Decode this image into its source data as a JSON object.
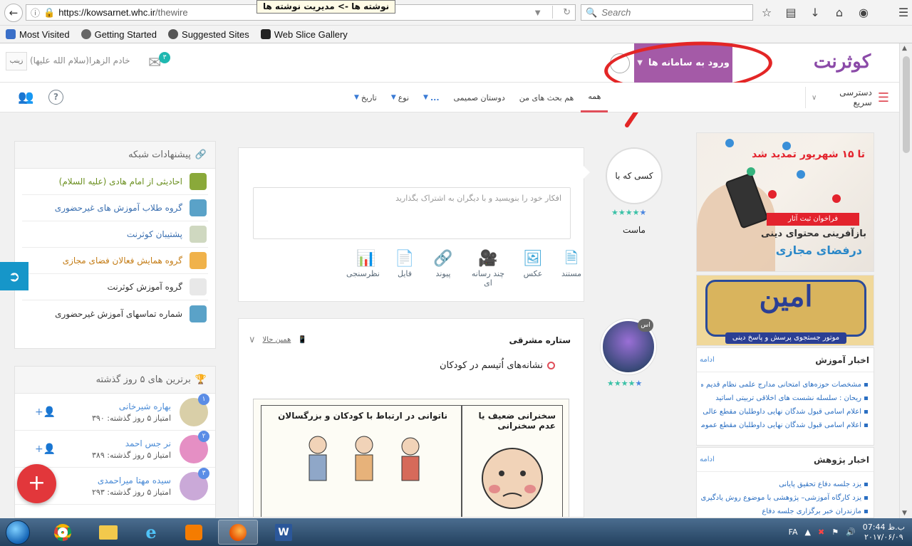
{
  "browser": {
    "url_host": "https://kowsarnet.whc.ir",
    "url_path": "/thewire",
    "tooltip": "نوشته ها -> مدیریت نوشته ها",
    "search_placeholder": "Search"
  },
  "bookmarks": [
    {
      "label": "Most Visited",
      "icon": "star-icon"
    },
    {
      "label": "Getting Started",
      "icon": "firefox-icon"
    },
    {
      "label": "Suggested Sites",
      "icon": "ie-icon"
    },
    {
      "label": "Web Slice Gallery",
      "icon": "slice-icon"
    }
  ],
  "header": {
    "logo_text": "کوثرنت",
    "login_label": "ورود به سامانه ها",
    "admin_name": "خادم الزهرا(سلام الله علیها)",
    "admin_avatar_text": "زینب",
    "mail_count": "۳"
  },
  "subnav": {
    "quick_access": "دسترسی سریع",
    "tabs": [
      {
        "label": "همه",
        "active": true
      },
      {
        "label": "هم بحث های من"
      },
      {
        "label": "دوستان صمیمی"
      },
      {
        "label": "..."
      },
      {
        "label": "نوع"
      },
      {
        "label": "تاریخ"
      }
    ]
  },
  "suggestions": {
    "title": "پیشنهادات شبکه",
    "items": [
      {
        "label": "احادیثی از امام هادی (علیه السلام)",
        "color": "#6a8f1f",
        "thumb": "#8aa93a"
      },
      {
        "label": "گروه طلاب آموزش های غیرحضوری",
        "color": "#3a6fb0",
        "thumb": "#5aa2c8"
      },
      {
        "label": "پشتیبان کوثرنت",
        "color": "#3a6fb0",
        "thumb": "#cfd8c0"
      },
      {
        "label": "گروه همایش فعالان فضای مجازی",
        "color": "#c47d17",
        "thumb": "#f0b24a"
      },
      {
        "label": "گروه آموزش کوثرنت",
        "color": "#333333",
        "thumb": "#e8e8e8"
      },
      {
        "label": "شماره تماسهای آموزش غیرحضوری",
        "color": "#333333",
        "thumb": "#5aa2c8"
      }
    ]
  },
  "top_users": {
    "title": "برترین های ۵ روز گذشته",
    "items": [
      {
        "rank": "۱",
        "name": "بهاره شیرخانی",
        "score": "امتیاز ۵ روز گذشته: ۳۹۰",
        "avatar": "#d9cfa8"
      },
      {
        "rank": "۲",
        "name": "نر جس احمد",
        "score": "امتیاز ۵ روز گذشته: ۳۸۹",
        "avatar": "#e58fc4"
      },
      {
        "rank": "۳",
        "name": "سیده مهتا میراحمدی",
        "score": "امتیاز ۵ روز گذشته: ۲۹۳",
        "avatar": "#caa9d8"
      }
    ]
  },
  "composer": {
    "placeholder": "افکار خود را بنویسید و با دیگران به اشتراک بگذارید",
    "avatar_text": "کسی که با ماست",
    "tools": [
      {
        "label": "مستند",
        "icon": "document-icon",
        "glyph": "📄"
      },
      {
        "label": "عکس",
        "icon": "image-icon",
        "glyph": "🖼"
      },
      {
        "label": "چند رسانه ای",
        "icon": "video-icon",
        "glyph": "🎥"
      },
      {
        "label": "پیوند",
        "icon": "link-icon",
        "glyph": "🔗"
      },
      {
        "label": "فایل",
        "icon": "file-icon",
        "glyph": "📁"
      },
      {
        "label": "نظرسنجی",
        "icon": "poll-icon",
        "glyph": "📊"
      }
    ]
  },
  "feed": {
    "author": "ستاره مشرقی",
    "time": "همین حالا",
    "text": "نشانه‌های اُتیسم در کودکان",
    "avatar_badge": "اس",
    "caption_left": "ناتوانی در ارتباط با کودکان و بزرگسالان",
    "caption_right": "سخنرانی ضعیف یا عدم سخنرانی"
  },
  "ads": {
    "ad1_title": "تا ۱۵ شهریور تمدید شد",
    "ad1_bar": "فراخوان ثبت آثار",
    "ad1_line2": "بازآفرینی محتوای دینی",
    "ad1_line3": "درفضای مجازی",
    "ad2_big": "امین",
    "ad2_sub": "موتور جستجوی پرسش و پاسخ دینی"
  },
  "news_education": {
    "title": "اخبار آموزش",
    "more": "ادامه",
    "items": [
      "مشخصات حوزه‌های امتحانی مدارج علمی نظام قدیم مرحله هفت",
      "ریحان : سلسله نشست های اخلاقی تربیتی اساتید",
      "اعلام اسامی قبول شدگان نهایی داوطلبان مقطع عالی",
      "اعلام اسامی قبول شدگان نهایی داوطلبان مقطع عمومی"
    ]
  },
  "news_research": {
    "title": "اخبار پژوهش",
    "more": "ادامه",
    "items": [
      "یزد جلسه دفاع تحقیق پایانی",
      "یزد کارگاه آموزشی– پژوهشی با موضوع روش یادگیری",
      "مازندران خبر برگزاری جلسه دفاع"
    ]
  },
  "taskbar": {
    "lang": "FA",
    "time": "07:44 ب.ظ",
    "date": "۲۰۱۷/۰۶/۰۹"
  },
  "colors": {
    "brand_purple": "#a45aa7",
    "accent_red": "#e04e59",
    "link_blue": "#2b6fc2"
  }
}
